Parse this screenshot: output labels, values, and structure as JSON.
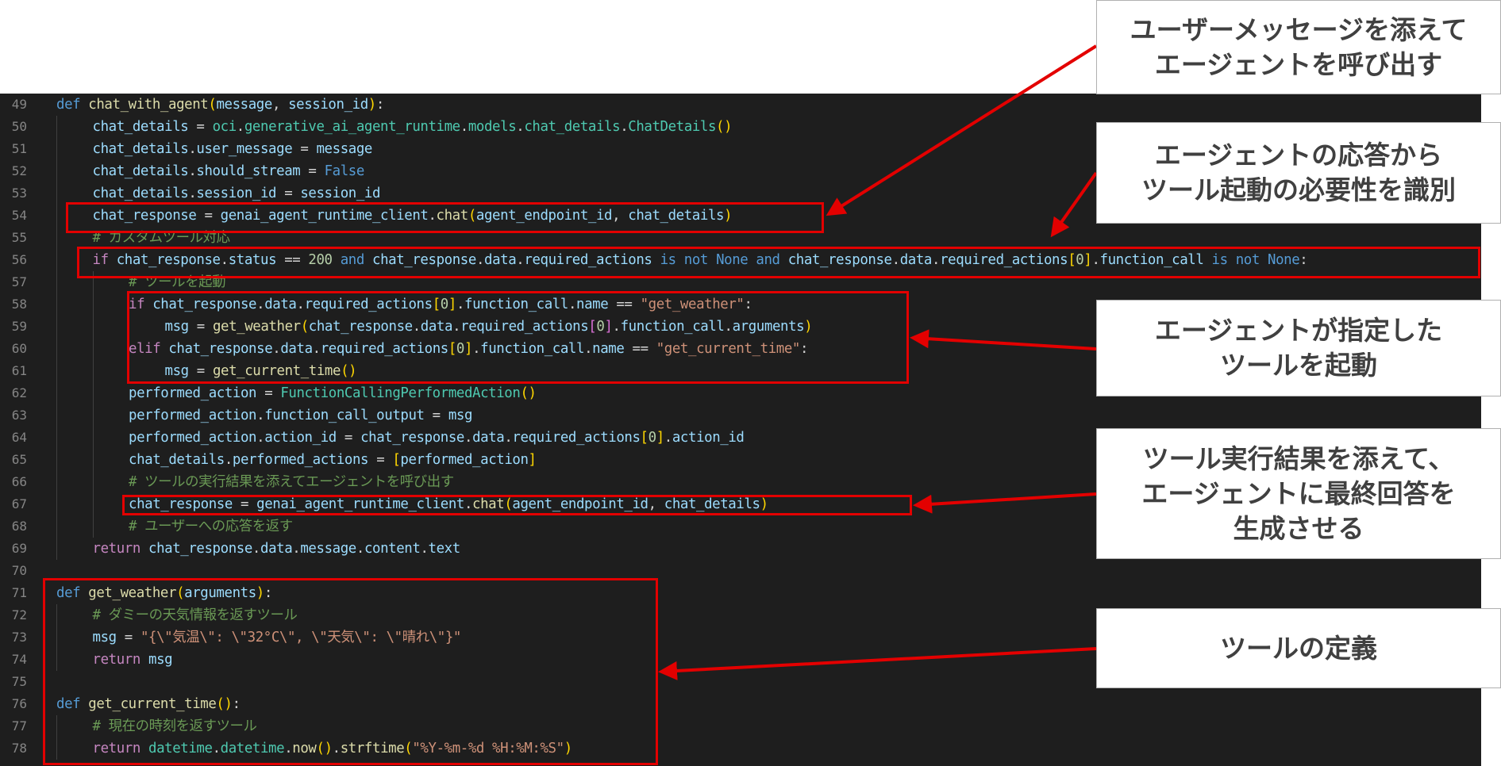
{
  "code_lines": [
    {
      "n": "49",
      "indent": 0,
      "tokens": [
        {
          "t": "def",
          "c": "kw"
        },
        {
          "t": " "
        },
        {
          "t": "chat_with_agent",
          "c": "fn"
        },
        {
          "t": "(",
          "c": "br1"
        },
        {
          "t": "message",
          "c": "var"
        },
        {
          "t": ", "
        },
        {
          "t": "session_id",
          "c": "var"
        },
        {
          "t": ")",
          "c": "br1"
        },
        {
          "t": ":"
        }
      ]
    },
    {
      "n": "50",
      "indent": 1,
      "tokens": [
        {
          "t": "chat_details",
          "c": "var"
        },
        {
          "t": " = "
        },
        {
          "t": "oci",
          "c": "cls"
        },
        {
          "t": "."
        },
        {
          "t": "generative_ai_agent_runtime",
          "c": "cls"
        },
        {
          "t": "."
        },
        {
          "t": "models",
          "c": "cls"
        },
        {
          "t": "."
        },
        {
          "t": "chat_details",
          "c": "cls"
        },
        {
          "t": "."
        },
        {
          "t": "ChatDetails",
          "c": "cls"
        },
        {
          "t": "()",
          "c": "br1"
        }
      ]
    },
    {
      "n": "51",
      "indent": 1,
      "tokens": [
        {
          "t": "chat_details",
          "c": "var"
        },
        {
          "t": "."
        },
        {
          "t": "user_message",
          "c": "var"
        },
        {
          "t": " = "
        },
        {
          "t": "message",
          "c": "var"
        }
      ]
    },
    {
      "n": "52",
      "indent": 1,
      "tokens": [
        {
          "t": "chat_details",
          "c": "var"
        },
        {
          "t": "."
        },
        {
          "t": "should_stream",
          "c": "var"
        },
        {
          "t": " = "
        },
        {
          "t": "False",
          "c": "kw"
        }
      ]
    },
    {
      "n": "53",
      "indent": 1,
      "tokens": [
        {
          "t": "chat_details",
          "c": "var"
        },
        {
          "t": "."
        },
        {
          "t": "session_id",
          "c": "var"
        },
        {
          "t": " = "
        },
        {
          "t": "session_id",
          "c": "var"
        }
      ]
    },
    {
      "n": "54",
      "indent": 1,
      "tokens": [
        {
          "t": "chat_response",
          "c": "var"
        },
        {
          "t": " = "
        },
        {
          "t": "genai_agent_runtime_client",
          "c": "var"
        },
        {
          "t": "."
        },
        {
          "t": "chat",
          "c": "fn"
        },
        {
          "t": "(",
          "c": "br1"
        },
        {
          "t": "agent_endpoint_id",
          "c": "var"
        },
        {
          "t": ", "
        },
        {
          "t": "chat_details",
          "c": "var"
        },
        {
          "t": ")",
          "c": "br1"
        }
      ]
    },
    {
      "n": "55",
      "indent": 1,
      "tokens": [
        {
          "t": "# カスタムツール対応",
          "c": "cmt"
        }
      ]
    },
    {
      "n": "56",
      "indent": 1,
      "tokens": [
        {
          "t": "if",
          "c": "ctl"
        },
        {
          "t": " "
        },
        {
          "t": "chat_response",
          "c": "var"
        },
        {
          "t": "."
        },
        {
          "t": "status",
          "c": "var"
        },
        {
          "t": " == "
        },
        {
          "t": "200",
          "c": "num"
        },
        {
          "t": " "
        },
        {
          "t": "and",
          "c": "kw"
        },
        {
          "t": " "
        },
        {
          "t": "chat_response",
          "c": "var"
        },
        {
          "t": "."
        },
        {
          "t": "data",
          "c": "var"
        },
        {
          "t": "."
        },
        {
          "t": "required_actions",
          "c": "var"
        },
        {
          "t": " "
        },
        {
          "t": "is not None and",
          "c": "kw"
        },
        {
          "t": " "
        },
        {
          "t": "chat_response",
          "c": "var"
        },
        {
          "t": "."
        },
        {
          "t": "data",
          "c": "var"
        },
        {
          "t": "."
        },
        {
          "t": "required_actions",
          "c": "var"
        },
        {
          "t": "[",
          "c": "br1"
        },
        {
          "t": "0",
          "c": "num"
        },
        {
          "t": "]",
          "c": "br1"
        },
        {
          "t": "."
        },
        {
          "t": "function_call",
          "c": "var"
        },
        {
          "t": " "
        },
        {
          "t": "is not None",
          "c": "kw"
        },
        {
          "t": ":"
        }
      ]
    },
    {
      "n": "57",
      "indent": 2,
      "tokens": [
        {
          "t": "# ツールを起動",
          "c": "cmt"
        }
      ]
    },
    {
      "n": "58",
      "indent": 2,
      "tokens": [
        {
          "t": "if",
          "c": "ctl"
        },
        {
          "t": " "
        },
        {
          "t": "chat_response",
          "c": "var"
        },
        {
          "t": "."
        },
        {
          "t": "data",
          "c": "var"
        },
        {
          "t": "."
        },
        {
          "t": "required_actions",
          "c": "var"
        },
        {
          "t": "[",
          "c": "br1"
        },
        {
          "t": "0",
          "c": "num"
        },
        {
          "t": "]",
          "c": "br1"
        },
        {
          "t": "."
        },
        {
          "t": "function_call",
          "c": "var"
        },
        {
          "t": "."
        },
        {
          "t": "name",
          "c": "var"
        },
        {
          "t": " == "
        },
        {
          "t": "\"get_weather\"",
          "c": "str"
        },
        {
          "t": ":"
        }
      ]
    },
    {
      "n": "59",
      "indent": 3,
      "tokens": [
        {
          "t": "msg",
          "c": "var"
        },
        {
          "t": " = "
        },
        {
          "t": "get_weather",
          "c": "fn"
        },
        {
          "t": "(",
          "c": "br1"
        },
        {
          "t": "chat_response",
          "c": "var"
        },
        {
          "t": "."
        },
        {
          "t": "data",
          "c": "var"
        },
        {
          "t": "."
        },
        {
          "t": "required_actions",
          "c": "var"
        },
        {
          "t": "[",
          "c": "br2"
        },
        {
          "t": "0",
          "c": "num"
        },
        {
          "t": "]",
          "c": "br2"
        },
        {
          "t": "."
        },
        {
          "t": "function_call",
          "c": "var"
        },
        {
          "t": "."
        },
        {
          "t": "arguments",
          "c": "var"
        },
        {
          "t": ")",
          "c": "br1"
        }
      ]
    },
    {
      "n": "60",
      "indent": 2,
      "tokens": [
        {
          "t": "elif",
          "c": "ctl"
        },
        {
          "t": " "
        },
        {
          "t": "chat_response",
          "c": "var"
        },
        {
          "t": "."
        },
        {
          "t": "data",
          "c": "var"
        },
        {
          "t": "."
        },
        {
          "t": "required_actions",
          "c": "var"
        },
        {
          "t": "[",
          "c": "br1"
        },
        {
          "t": "0",
          "c": "num"
        },
        {
          "t": "]",
          "c": "br1"
        },
        {
          "t": "."
        },
        {
          "t": "function_call",
          "c": "var"
        },
        {
          "t": "."
        },
        {
          "t": "name",
          "c": "var"
        },
        {
          "t": " == "
        },
        {
          "t": "\"get_current_time\"",
          "c": "str"
        },
        {
          "t": ":"
        }
      ]
    },
    {
      "n": "61",
      "indent": 3,
      "tokens": [
        {
          "t": "msg",
          "c": "var"
        },
        {
          "t": " = "
        },
        {
          "t": "get_current_time",
          "c": "fn"
        },
        {
          "t": "()",
          "c": "br1"
        }
      ]
    },
    {
      "n": "62",
      "indent": 2,
      "tokens": [
        {
          "t": "performed_action",
          "c": "var"
        },
        {
          "t": " = "
        },
        {
          "t": "FunctionCallingPerformedAction",
          "c": "cls"
        },
        {
          "t": "()",
          "c": "br1"
        }
      ]
    },
    {
      "n": "63",
      "indent": 2,
      "tokens": [
        {
          "t": "performed_action",
          "c": "var"
        },
        {
          "t": "."
        },
        {
          "t": "function_call_output",
          "c": "var"
        },
        {
          "t": " = "
        },
        {
          "t": "msg",
          "c": "var"
        }
      ]
    },
    {
      "n": "64",
      "indent": 2,
      "tokens": [
        {
          "t": "performed_action",
          "c": "var"
        },
        {
          "t": "."
        },
        {
          "t": "action_id",
          "c": "var"
        },
        {
          "t": " = "
        },
        {
          "t": "chat_response",
          "c": "var"
        },
        {
          "t": "."
        },
        {
          "t": "data",
          "c": "var"
        },
        {
          "t": "."
        },
        {
          "t": "required_actions",
          "c": "var"
        },
        {
          "t": "[",
          "c": "br1"
        },
        {
          "t": "0",
          "c": "num"
        },
        {
          "t": "]",
          "c": "br1"
        },
        {
          "t": "."
        },
        {
          "t": "action_id",
          "c": "var"
        }
      ]
    },
    {
      "n": "65",
      "indent": 2,
      "tokens": [
        {
          "t": "chat_details",
          "c": "var"
        },
        {
          "t": "."
        },
        {
          "t": "performed_actions",
          "c": "var"
        },
        {
          "t": " = "
        },
        {
          "t": "[",
          "c": "br1"
        },
        {
          "t": "performed_action",
          "c": "var"
        },
        {
          "t": "]",
          "c": "br1"
        }
      ]
    },
    {
      "n": "66",
      "indent": 2,
      "tokens": [
        {
          "t": "# ツールの実行結果を添えてエージェントを呼び出す",
          "c": "cmt"
        }
      ]
    },
    {
      "n": "67",
      "indent": 2,
      "tokens": [
        {
          "t": "chat_response",
          "c": "var"
        },
        {
          "t": " = "
        },
        {
          "t": "genai_agent_runtime_client",
          "c": "var"
        },
        {
          "t": "."
        },
        {
          "t": "chat",
          "c": "fn"
        },
        {
          "t": "(",
          "c": "br1"
        },
        {
          "t": "agent_endpoint_id",
          "c": "var"
        },
        {
          "t": ", "
        },
        {
          "t": "chat_details",
          "c": "var"
        },
        {
          "t": ")",
          "c": "br1"
        }
      ]
    },
    {
      "n": "68",
      "indent": 2,
      "tokens": [
        {
          "t": "# ユーザーへの応答を返す",
          "c": "cmt"
        }
      ]
    },
    {
      "n": "69",
      "indent": 1,
      "tokens": [
        {
          "t": "return",
          "c": "ctl"
        },
        {
          "t": " "
        },
        {
          "t": "chat_response",
          "c": "var"
        },
        {
          "t": "."
        },
        {
          "t": "data",
          "c": "var"
        },
        {
          "t": "."
        },
        {
          "t": "message",
          "c": "var"
        },
        {
          "t": "."
        },
        {
          "t": "content",
          "c": "var"
        },
        {
          "t": "."
        },
        {
          "t": "text",
          "c": "var"
        }
      ]
    },
    {
      "n": "70",
      "indent": 0,
      "tokens": []
    },
    {
      "n": "71",
      "indent": 0,
      "tokens": [
        {
          "t": "def",
          "c": "kw"
        },
        {
          "t": " "
        },
        {
          "t": "get_weather",
          "c": "fn"
        },
        {
          "t": "(",
          "c": "br1"
        },
        {
          "t": "arguments",
          "c": "var"
        },
        {
          "t": ")",
          "c": "br1"
        },
        {
          "t": ":"
        }
      ]
    },
    {
      "n": "72",
      "indent": 1,
      "tokens": [
        {
          "t": "# ダミーの天気情報を返すツール",
          "c": "cmt"
        }
      ]
    },
    {
      "n": "73",
      "indent": 1,
      "tokens": [
        {
          "t": "msg",
          "c": "var"
        },
        {
          "t": " = "
        },
        {
          "t": "\"{\\\"気温\\\": \\\"32°C\\\", \\\"天気\\\": \\\"晴れ\\\"}\"",
          "c": "str"
        }
      ]
    },
    {
      "n": "74",
      "indent": 1,
      "tokens": [
        {
          "t": "return",
          "c": "ctl"
        },
        {
          "t": " "
        },
        {
          "t": "msg",
          "c": "var"
        }
      ]
    },
    {
      "n": "75",
      "indent": 0,
      "tokens": []
    },
    {
      "n": "76",
      "indent": 0,
      "tokens": [
        {
          "t": "def",
          "c": "kw"
        },
        {
          "t": " "
        },
        {
          "t": "get_current_time",
          "c": "fn"
        },
        {
          "t": "()",
          "c": "br1"
        },
        {
          "t": ":"
        }
      ]
    },
    {
      "n": "77",
      "indent": 1,
      "tokens": [
        {
          "t": "# 現在の時刻を返すツール",
          "c": "cmt"
        }
      ]
    },
    {
      "n": "78",
      "indent": 1,
      "tokens": [
        {
          "t": "return",
          "c": "ctl"
        },
        {
          "t": " "
        },
        {
          "t": "datetime",
          "c": "cls"
        },
        {
          "t": "."
        },
        {
          "t": "datetime",
          "c": "cls"
        },
        {
          "t": "."
        },
        {
          "t": "now",
          "c": "fn"
        },
        {
          "t": "()",
          "c": "br1"
        },
        {
          "t": "."
        },
        {
          "t": "strftime",
          "c": "fn"
        },
        {
          "t": "(",
          "c": "br1"
        },
        {
          "t": "\"%Y-%m-%d %H:%M:%S\"",
          "c": "str"
        },
        {
          "t": ")",
          "c": "br1"
        }
      ]
    }
  ],
  "callouts": [
    {
      "lines": [
        "ユーザーメッセージを添えて",
        "エージェントを呼び出す"
      ]
    },
    {
      "lines": [
        "エージェントの応答から",
        "ツール起動の必要性を識別"
      ]
    },
    {
      "lines": [
        "エージェントが指定した",
        "ツールを起動"
      ]
    },
    {
      "lines": [
        "ツール実行結果を添えて、",
        "エージェントに最終回答を",
        "生成させる"
      ]
    },
    {
      "lines": [
        "ツールの定義"
      ]
    }
  ],
  "colors": {
    "editor_bg": "#1e1e1e",
    "line_number": "#858585",
    "highlight_red": "#e30000",
    "callout_text": "#404040"
  }
}
